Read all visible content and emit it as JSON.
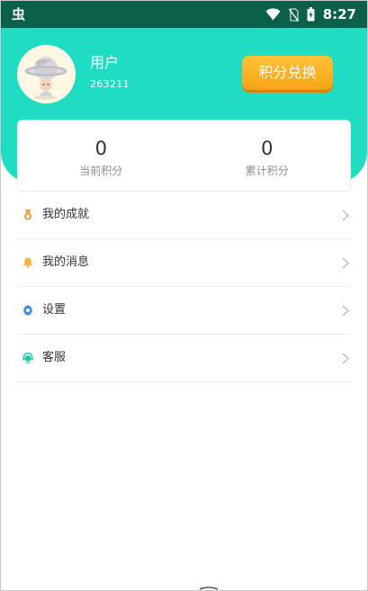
{
  "status_bar": {
    "app_glyph": "虫",
    "time": "8:27",
    "icons": [
      "wifi-icon",
      "no-sim-icon",
      "battery-charging-icon"
    ]
  },
  "profile": {
    "username": "用户",
    "user_id": "263211",
    "avatar_icon": "planet-astronaut-avatar",
    "exchange_button": "积分兑换"
  },
  "points": {
    "current_value": "0",
    "current_label": "当前积分",
    "total_value": "0",
    "total_label": "累计积分"
  },
  "menu": {
    "items": [
      {
        "label": "我的成就",
        "icon": "medal-icon",
        "icon_color": "#f29b3a"
      },
      {
        "label": "我的消息",
        "icon": "bell-icon",
        "icon_color": "#f7b53b"
      },
      {
        "label": "设置",
        "icon": "gear-icon",
        "icon_color": "#3d8be0"
      },
      {
        "label": "客服",
        "icon": "customer-service-icon",
        "icon_color": "#1fc7a8"
      }
    ]
  },
  "colors": {
    "status_bar": "#0b6049",
    "header_teal": "#1fdcc2",
    "button_orange": "#f5a315",
    "text_dark": "#333333",
    "text_muted": "#8c8c8c",
    "divider": "#ececec"
  }
}
